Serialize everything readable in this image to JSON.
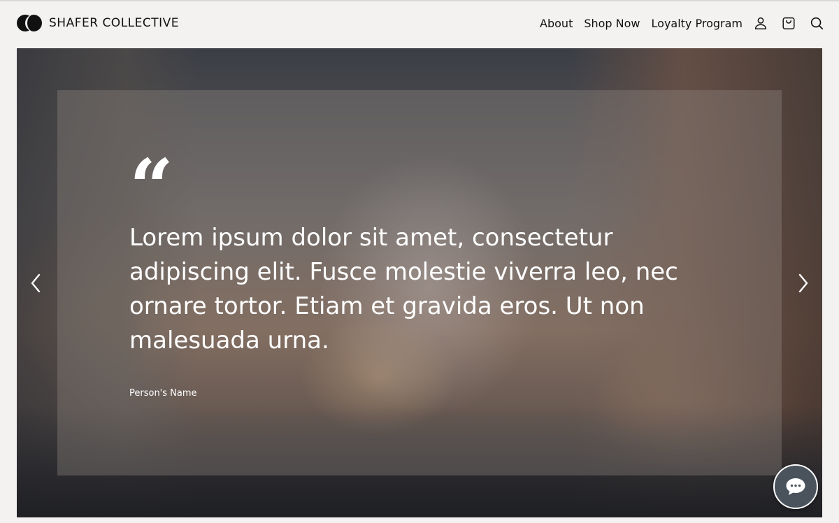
{
  "brand": {
    "name": "SHAFER COLLECTIVE",
    "logo_icon": "two-circles-logo"
  },
  "nav": {
    "links": [
      "About",
      "Shop Now",
      "Loyalty Program"
    ],
    "icons": [
      "user-icon",
      "shopping-bag-icon",
      "search-icon"
    ]
  },
  "testimonial": {
    "quote_mark": "“",
    "text": "Lorem ipsum dolor sit amet, consectetur adipiscing elit. Fusce molestie viverra leo, nec ornare tortor. Etiam et gravida eros. Ut non malesuada urna.",
    "person": "Person's Name"
  },
  "controls": {
    "prev_icon": "chevron-left-icon",
    "next_icon": "chevron-right-icon",
    "chat_icon": "chat-bubble-icon"
  },
  "colors": {
    "page_background": "#f3f2f0",
    "text_dark": "#111111",
    "overlay_text": "#ffffff",
    "chat_button": "#4a535c"
  }
}
